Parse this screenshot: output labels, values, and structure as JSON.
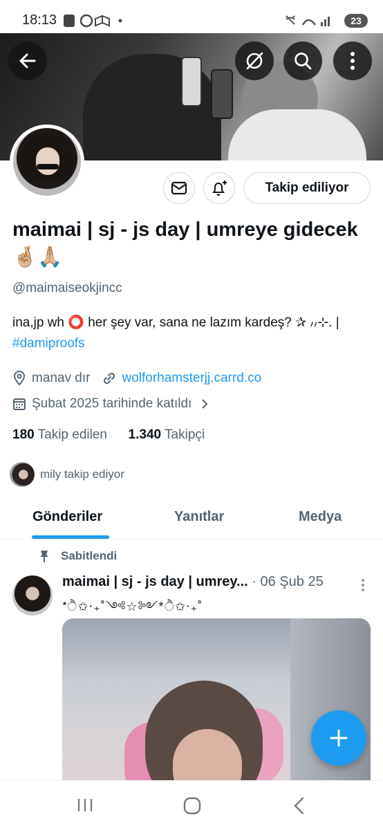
{
  "status_bar": {
    "time": "18:13",
    "battery": "23"
  },
  "header": {
    "back_icon": "back-arrow-icon",
    "grok_icon": "grok-icon",
    "search_icon": "search-icon",
    "more_icon": "more-vertical-icon"
  },
  "profile": {
    "display_name": "maimai | sj - js day | umreye gidecek 🤞🏼🙏🏼",
    "handle": "@maimaiseokjincc",
    "bio_text": "ina,jp wh ⭕ her şey var, sana ne lazım kardeş? ✰ ៸៸⊹. | ",
    "bio_hashtag": "#damiproofs",
    "location": "manav dır",
    "website": "wolforhamsterjj.carrd.co",
    "joined": "Şubat 2025 tarihinde katıldı",
    "following_count": "180",
    "following_label": "Takip edilen",
    "followers_count": "1.340",
    "followers_label": "Takipçi",
    "followed_by": "mily takip ediyor"
  },
  "actions": {
    "follow_label": "Takip ediliyor",
    "message_icon": "mail-icon",
    "notify_icon": "bell-plus-icon"
  },
  "tabs": [
    {
      "label": "Gönderiler",
      "active": true
    },
    {
      "label": "Yanıtlar",
      "active": false
    },
    {
      "label": "Medya",
      "active": false
    }
  ],
  "pinned_tweet": {
    "pinned_label": "Sabitlendi",
    "author": "maimai | sj - js day | umrey...",
    "time": "· 06 Şub 25",
    "text": "*ੈ✩‧₊˚༺☆༻*ੈ✩‧₊˚"
  },
  "colors": {
    "accent": "#1d9bf0",
    "text": "#0f1419",
    "secondary": "#536471"
  }
}
